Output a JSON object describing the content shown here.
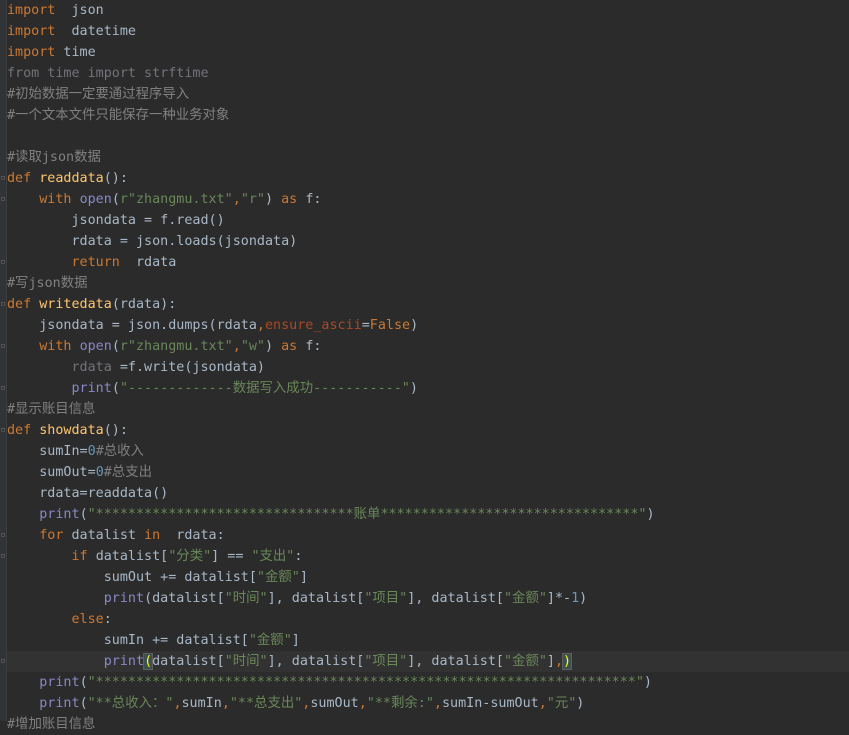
{
  "editor": {
    "lines": [
      {
        "segments": [
          {
            "t": "import",
            "c": "kw"
          },
          {
            "t": "  ",
            "c": ""
          },
          {
            "t": "json",
            "c": ""
          }
        ]
      },
      {
        "segments": [
          {
            "t": "import",
            "c": "kw"
          },
          {
            "t": "  ",
            "c": ""
          },
          {
            "t": "datetime",
            "c": ""
          }
        ]
      },
      {
        "segments": [
          {
            "t": "import",
            "c": "kw"
          },
          {
            "t": " time",
            "c": ""
          }
        ]
      },
      {
        "segments": [
          {
            "t": "from time import strftime",
            "c": "dim"
          }
        ]
      },
      {
        "segments": [
          {
            "t": "#初始数据一定要通过程序导入",
            "c": "cm"
          }
        ]
      },
      {
        "segments": [
          {
            "t": "#一个文本文件只能保存一种业务对象",
            "c": "cm"
          }
        ]
      },
      {
        "segments": []
      },
      {
        "segments": [
          {
            "t": "#读取json数据",
            "c": "cm"
          }
        ]
      },
      {
        "fold": true,
        "segments": [
          {
            "t": "def ",
            "c": "kw"
          },
          {
            "t": "readdata",
            "c": "fn"
          },
          {
            "t": "():",
            "c": ""
          }
        ]
      },
      {
        "fold": true,
        "segments": [
          {
            "t": "    ",
            "c": ""
          },
          {
            "t": "with ",
            "c": "kw"
          },
          {
            "t": "open",
            "c": "bi"
          },
          {
            "t": "(",
            "c": ""
          },
          {
            "t": "r\"zhangmu.txt\"",
            "c": "str"
          },
          {
            "t": ",",
            "c": "kw"
          },
          {
            "t": "\"r\"",
            "c": "str"
          },
          {
            "t": ") ",
            "c": ""
          },
          {
            "t": "as ",
            "c": "kw"
          },
          {
            "t": "f:",
            "c": ""
          }
        ]
      },
      {
        "segments": [
          {
            "t": "        jsondata = f.read()",
            "c": ""
          }
        ]
      },
      {
        "segments": [
          {
            "t": "        rdata = json.loads(jsondata)",
            "c": ""
          }
        ]
      },
      {
        "fold": true,
        "segments": [
          {
            "t": "        ",
            "c": ""
          },
          {
            "t": "return",
            "c": "kw"
          },
          {
            "t": "  rdata",
            "c": ""
          }
        ]
      },
      {
        "segments": [
          {
            "t": "#写json数据",
            "c": "cm"
          }
        ]
      },
      {
        "fold": true,
        "segments": [
          {
            "t": "def ",
            "c": "kw"
          },
          {
            "t": "writedata",
            "c": "fn"
          },
          {
            "t": "(rdata):",
            "c": ""
          }
        ]
      },
      {
        "segments": [
          {
            "t": "    jsondata = json.dumps(rdata",
            "c": ""
          },
          {
            "t": ",",
            "c": "kw"
          },
          {
            "t": "ensure_ascii",
            "c": "param"
          },
          {
            "t": "=",
            "c": ""
          },
          {
            "t": "False",
            "c": "kw"
          },
          {
            "t": ")",
            "c": ""
          }
        ]
      },
      {
        "fold": true,
        "segments": [
          {
            "t": "    ",
            "c": ""
          },
          {
            "t": "with ",
            "c": "kw"
          },
          {
            "t": "open",
            "c": "bi"
          },
          {
            "t": "(",
            "c": ""
          },
          {
            "t": "r\"zhangmu.txt\"",
            "c": "str"
          },
          {
            "t": ",",
            "c": "kw"
          },
          {
            "t": "\"w\"",
            "c": "str"
          },
          {
            "t": ") ",
            "c": ""
          },
          {
            "t": "as ",
            "c": "kw"
          },
          {
            "t": "f:",
            "c": ""
          }
        ]
      },
      {
        "segments": [
          {
            "t": "        ",
            "c": ""
          },
          {
            "t": "rdata",
            "c": "unused"
          },
          {
            "t": " =f.write(jsondata)",
            "c": ""
          }
        ]
      },
      {
        "fold": true,
        "segments": [
          {
            "t": "        ",
            "c": ""
          },
          {
            "t": "print",
            "c": "bi"
          },
          {
            "t": "(",
            "c": ""
          },
          {
            "t": "\"-------------数据写入成功-----------\"",
            "c": "str"
          },
          {
            "t": ")",
            "c": ""
          }
        ]
      },
      {
        "segments": [
          {
            "t": "#显示账目信息",
            "c": "cm"
          }
        ]
      },
      {
        "fold": true,
        "segments": [
          {
            "t": "def ",
            "c": "kw"
          },
          {
            "t": "showdata",
            "c": "fn"
          },
          {
            "t": "():",
            "c": ""
          }
        ]
      },
      {
        "segments": [
          {
            "t": "    sumIn=",
            "c": ""
          },
          {
            "t": "0",
            "c": "num"
          },
          {
            "t": "#总收入",
            "c": "cm"
          }
        ]
      },
      {
        "segments": [
          {
            "t": "    sumOut=",
            "c": ""
          },
          {
            "t": "0",
            "c": "num"
          },
          {
            "t": "#总支出",
            "c": "cm"
          }
        ]
      },
      {
        "segments": [
          {
            "t": "    rdata=readdata()",
            "c": ""
          }
        ]
      },
      {
        "segments": [
          {
            "t": "    ",
            "c": ""
          },
          {
            "t": "print",
            "c": "bi"
          },
          {
            "t": "(",
            "c": ""
          },
          {
            "t": "\"********************************账单********************************\"",
            "c": "str"
          },
          {
            "t": ")",
            "c": ""
          }
        ]
      },
      {
        "fold": true,
        "segments": [
          {
            "t": "    ",
            "c": ""
          },
          {
            "t": "for ",
            "c": "kw"
          },
          {
            "t": "datalist ",
            "c": ""
          },
          {
            "t": "in",
            "c": "kw"
          },
          {
            "t": "  rdata:",
            "c": ""
          }
        ]
      },
      {
        "fold": true,
        "segments": [
          {
            "t": "        ",
            "c": ""
          },
          {
            "t": "if ",
            "c": "kw"
          },
          {
            "t": "datalist[",
            "c": ""
          },
          {
            "t": "\"分类\"",
            "c": "str"
          },
          {
            "t": "] == ",
            "c": ""
          },
          {
            "t": "\"支出\"",
            "c": "str"
          },
          {
            "t": ":",
            "c": ""
          }
        ]
      },
      {
        "segments": [
          {
            "t": "            sumOut += datalist[",
            "c": ""
          },
          {
            "t": "\"金额\"",
            "c": "str"
          },
          {
            "t": "]",
            "c": ""
          }
        ]
      },
      {
        "segments": [
          {
            "t": "            ",
            "c": ""
          },
          {
            "t": "print",
            "c": "bi"
          },
          {
            "t": "(datalist[",
            "c": ""
          },
          {
            "t": "\"时间\"",
            "c": "str"
          },
          {
            "t": "], datalist[",
            "c": ""
          },
          {
            "t": "\"项目\"",
            "c": "str"
          },
          {
            "t": "], datalist[",
            "c": ""
          },
          {
            "t": "\"金额\"",
            "c": "str"
          },
          {
            "t": "]*-",
            "c": ""
          },
          {
            "t": "1",
            "c": "num"
          },
          {
            "t": ")",
            "c": ""
          }
        ]
      },
      {
        "segments": [
          {
            "t": "        ",
            "c": ""
          },
          {
            "t": "else",
            "c": "kw"
          },
          {
            "t": ":",
            "c": ""
          }
        ]
      },
      {
        "segments": [
          {
            "t": "            sumIn += datalist[",
            "c": ""
          },
          {
            "t": "\"金额\"",
            "c": "str"
          },
          {
            "t": "]",
            "c": ""
          }
        ]
      },
      {
        "current": true,
        "fold": true,
        "segments": [
          {
            "t": "            ",
            "c": ""
          },
          {
            "t": "print",
            "c": "bi"
          },
          {
            "t": "(",
            "c": "paren-match"
          },
          {
            "t": "datalist[",
            "c": ""
          },
          {
            "t": "\"时间\"",
            "c": "str"
          },
          {
            "t": "], datalist[",
            "c": ""
          },
          {
            "t": "\"项目\"",
            "c": "str"
          },
          {
            "t": "], datalist[",
            "c": ""
          },
          {
            "t": "\"金额\"",
            "c": "str"
          },
          {
            "t": "]",
            "c": ""
          },
          {
            "t": ",",
            "c": "kw"
          },
          {
            "t": ")",
            "c": "paren-match"
          }
        ]
      },
      {
        "segments": [
          {
            "t": "    ",
            "c": ""
          },
          {
            "t": "print",
            "c": "bi"
          },
          {
            "t": "(",
            "c": ""
          },
          {
            "t": "\"*******************************************************************\"",
            "c": "str"
          },
          {
            "t": ")",
            "c": ""
          }
        ]
      },
      {
        "segments": [
          {
            "t": "    ",
            "c": ""
          },
          {
            "t": "print",
            "c": "bi"
          },
          {
            "t": "(",
            "c": ""
          },
          {
            "t": "\"**总收入：\"",
            "c": "str"
          },
          {
            "t": ",",
            "c": "kw"
          },
          {
            "t": "sumIn",
            "c": ""
          },
          {
            "t": ",",
            "c": "kw"
          },
          {
            "t": "\"**总支出\"",
            "c": "str"
          },
          {
            "t": ",",
            "c": "kw"
          },
          {
            "t": "sumOut",
            "c": ""
          },
          {
            "t": ",",
            "c": "kw"
          },
          {
            "t": "\"**剩余:\"",
            "c": "str"
          },
          {
            "t": ",",
            "c": "kw"
          },
          {
            "t": "sumIn-sumOut",
            "c": ""
          },
          {
            "t": ",",
            "c": "kw"
          },
          {
            "t": "\"元\"",
            "c": "str"
          },
          {
            "t": ")",
            "c": ""
          }
        ]
      },
      {
        "segments": [
          {
            "t": "#增加账目信息",
            "c": "cm"
          }
        ]
      }
    ]
  }
}
